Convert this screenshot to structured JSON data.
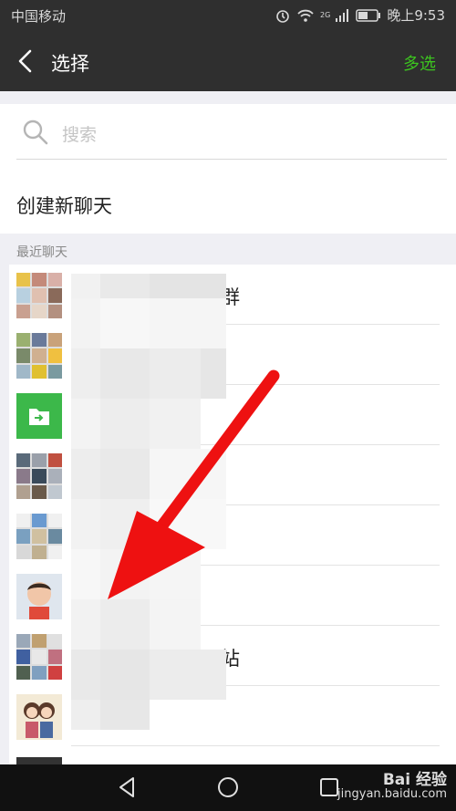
{
  "status_bar": {
    "carrier": "中国移动",
    "network": "2G",
    "time": "晚上9:53"
  },
  "header": {
    "title": "选择",
    "multi_select": "多选"
  },
  "search": {
    "placeholder": "搜索"
  },
  "new_chat": {
    "label": "创建新聊天"
  },
  "recent": {
    "section_label": "最近聊天",
    "items": [
      {
        "name_visible": "群"
      },
      {
        "name_visible": ""
      },
      {
        "name_visible": ""
      },
      {
        "name_visible": ""
      },
      {
        "name_visible": ""
      },
      {
        "name_visible": ""
      },
      {
        "name_visible": "站"
      },
      {
        "name_visible": ""
      }
    ]
  },
  "watermark": {
    "brand": "Bai 经验",
    "url": "jingyan.baidu.com"
  },
  "colors": {
    "accent_green": "#3cc51f",
    "header_bg": "#2f2f2f",
    "arrow_red": "#ee1111"
  }
}
